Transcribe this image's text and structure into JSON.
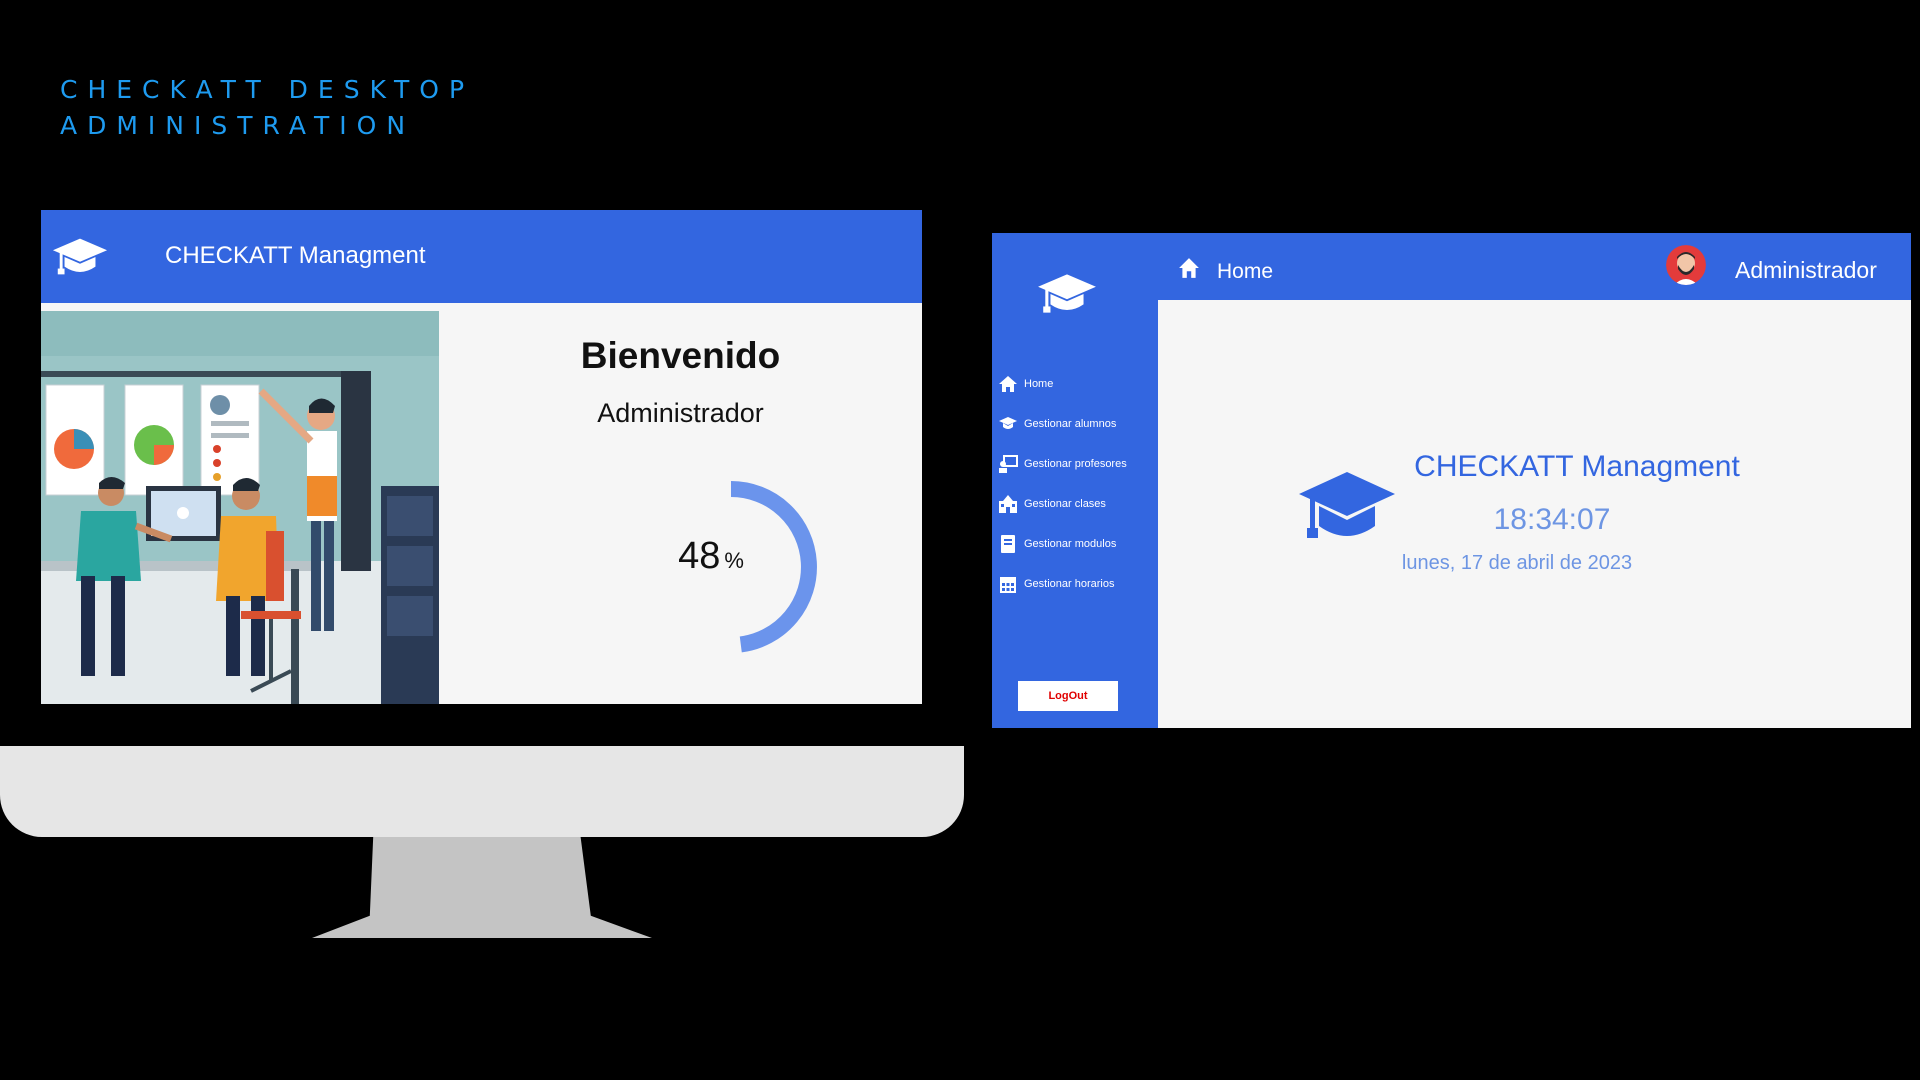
{
  "slide": {
    "title_line1": "CHECKATT DESKTOP",
    "title_line2": "ADMINISTRATION"
  },
  "login_screen": {
    "app_title": "CHECKATT Managment",
    "welcome": "Bienvenido",
    "user": "Administrador",
    "progress_value": "48",
    "progress_unit": "%",
    "progress_fraction": 0.48,
    "icons": {
      "logo": "graduation-cap-icon",
      "illustration": "office-team-illustration"
    }
  },
  "dashboard": {
    "breadcrumb": "Home",
    "user_name": "Administrador",
    "nav_items": [
      {
        "label": "Home",
        "icon": "home-icon"
      },
      {
        "label": "Gestionar alumnos",
        "icon": "graduation-cap-icon"
      },
      {
        "label": "Gestionar profesores",
        "icon": "teacher-board-icon"
      },
      {
        "label": "Gestionar clases",
        "icon": "school-building-icon"
      },
      {
        "label": "Gestionar modulos",
        "icon": "book-icon"
      },
      {
        "label": "Gestionar horarios",
        "icon": "calendar-icon"
      }
    ],
    "logout_label": "LogOut",
    "app_name": "CHECKATT Managment",
    "time": "18:34:07",
    "date": "lunes, 17 de abril de 2023"
  },
  "colors": {
    "accent_blue": "#3366e0",
    "slide_title": "#1e9bf0",
    "clock_text": "#6d95e3",
    "logout_text": "#e00000",
    "progress_arc": "#6b94ec"
  }
}
